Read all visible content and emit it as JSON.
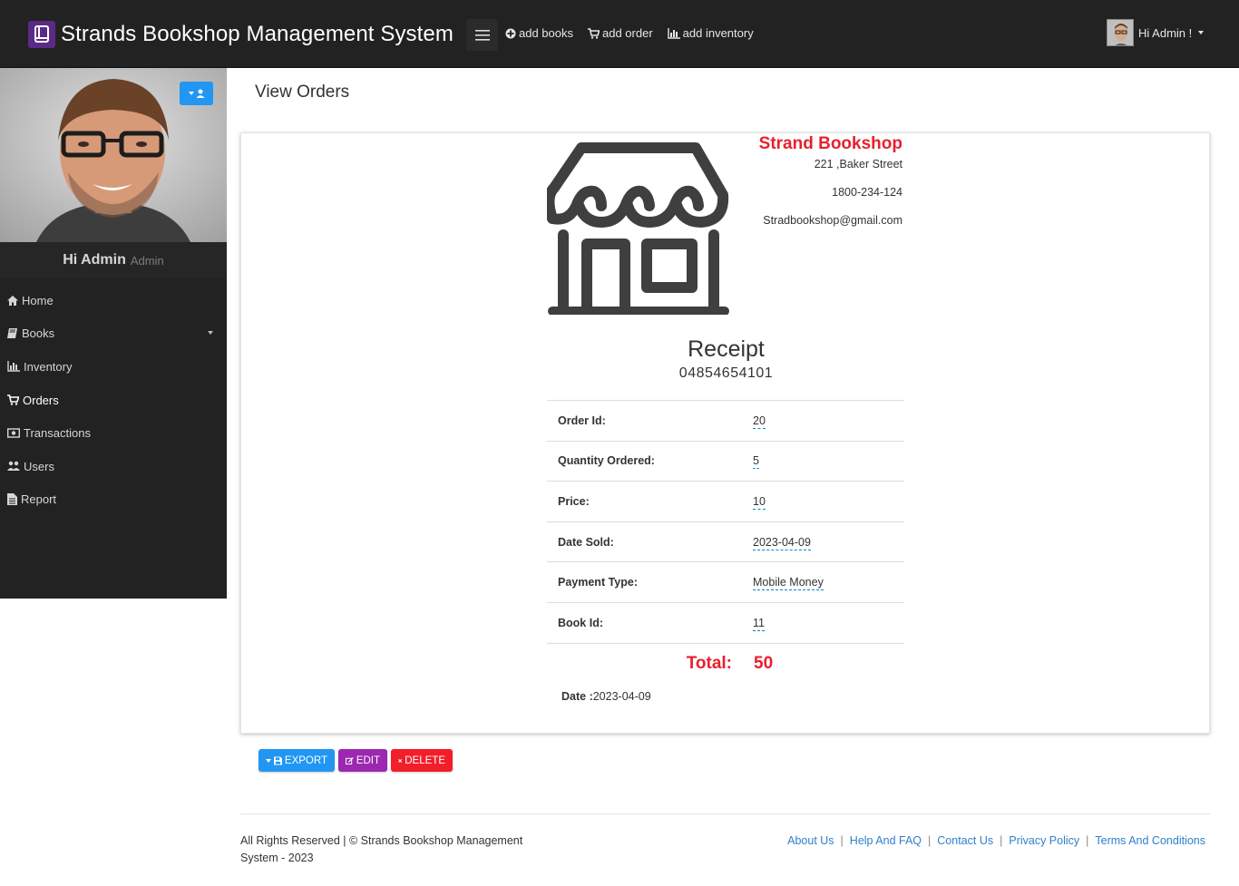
{
  "app": {
    "title": "Strands Bookshop Management System"
  },
  "topnav": {
    "links": [
      {
        "label": "add books",
        "icon": "plus-circle-icon"
      },
      {
        "label": "add order",
        "icon": "cart-icon"
      },
      {
        "label": "add inventory",
        "icon": "bar-chart-icon"
      }
    ],
    "user_greeting": "Hi Admin !"
  },
  "sidebar": {
    "profile": {
      "name": "Hi Admin",
      "role": "Admin"
    },
    "items": [
      {
        "label": "Home",
        "icon": "home-icon"
      },
      {
        "label": "Books",
        "icon": "book-icon",
        "has_submenu": true
      },
      {
        "label": "Inventory",
        "icon": "bar-chart-icon"
      },
      {
        "label": "Orders",
        "icon": "cart-icon",
        "active": true
      },
      {
        "label": "Transactions",
        "icon": "money-icon"
      },
      {
        "label": "Users",
        "icon": "users-icon"
      },
      {
        "label": "Report",
        "icon": "file-icon"
      }
    ]
  },
  "main": {
    "page_title": "View Orders",
    "shop": {
      "name": "Strand Bookshop",
      "address": "221 ,Baker Street",
      "phone": "1800-234-124",
      "email": "Stradbookshop@gmail.com"
    },
    "receipt": {
      "title": "Receipt",
      "number": "04854654101",
      "rows": [
        {
          "label": "Order Id:",
          "value": "20"
        },
        {
          "label": "Quantity Ordered:",
          "value": "5"
        },
        {
          "label": "Price:",
          "value": "10"
        },
        {
          "label": "Date Sold:",
          "value": "2023-04-09"
        },
        {
          "label": "Payment Type:",
          "value": "Mobile Money"
        },
        {
          "label": "Book Id:",
          "value": "11"
        }
      ],
      "total_label": "Total:",
      "total_value": "50",
      "date_label": "Date :",
      "date_value": "2023-04-09"
    },
    "actions": {
      "export": "EXPORT",
      "edit": "EDIT",
      "delete": "DELETE"
    }
  },
  "footer": {
    "copyright": "All Rights Reserved | © Strands Bookshop Management System - 2023",
    "links": [
      "About Us",
      "Help And FAQ",
      "Contact Us",
      "Privacy Policy",
      "Terms And Conditions"
    ]
  },
  "colors": {
    "topbar": "#222222",
    "sidebar": "#222222",
    "accent_red": "#e8202d",
    "export_blue": "#2196f3",
    "edit_purple": "#9c27b0",
    "delete_red": "#f21e2a",
    "link_blue": "#2f80c9"
  }
}
